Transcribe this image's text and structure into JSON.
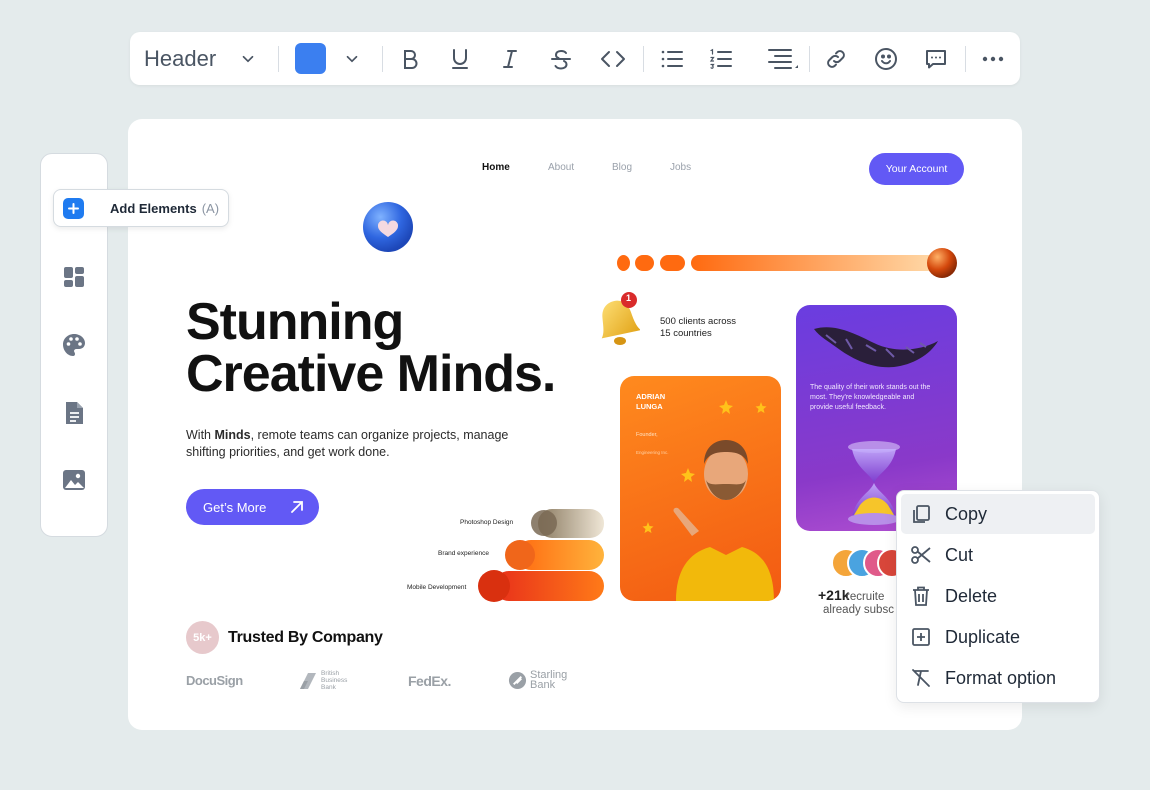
{
  "toolbar": {
    "heading_select": "Header",
    "color_swatch": "#3b7ff0",
    "icons": [
      "bold-icon",
      "underline-icon",
      "italic-icon",
      "strikethrough-icon",
      "code-icon",
      "bullet-list-icon",
      "numbered-list-icon",
      "align-right-icon",
      "link-icon",
      "emoji-icon",
      "comment-icon",
      "more-icon"
    ]
  },
  "sidebar": {
    "add_elements_label": "Add Elements",
    "add_elements_shortcut": "(A)",
    "items": [
      "layout-icon",
      "palette-icon",
      "document-icon",
      "image-icon"
    ]
  },
  "page": {
    "nav": {
      "home": "Home",
      "about": "About",
      "blog": "Blog",
      "jobs": "Jobs"
    },
    "account_button": "Your Account",
    "headline_line1": "Stunning",
    "headline_line2": "Creative Minds.",
    "subtitle_pre": "With ",
    "subtitle_bold": "Minds",
    "subtitle_post": ", remote teams can organize projects, manage shifting priorities, and get work done.",
    "cta_label": "Get’s More",
    "clients_line1": "500 clients across",
    "clients_line2": "15 countries",
    "notification_count": "1",
    "skills": [
      "Photoshop Design",
      "Brand experience",
      "Mobile Development"
    ],
    "profile": {
      "name_line1": "ADRIAN",
      "name_line2": "LUNGA",
      "role": "Founder,",
      "company": "Engineering Inc."
    },
    "testimonial": "The quality of their work stands out the most. They're knowledgeable and provide useful feedback.",
    "recruit_number": "+21k",
    "recruit_text1": "recruite",
    "recruit_text2": "already subsc",
    "trusted_badge": "5k+",
    "trusted_title": "Trusted By Company",
    "logos": {
      "docusign": "DocuSign",
      "bbb_line1": "British",
      "bbb_line2": "Business",
      "bbb_line3": "Bank",
      "fedex": "FedEx.",
      "starling1": "Starling",
      "starling2": "Bank"
    }
  },
  "context_menu": {
    "items": [
      {
        "label": "Copy",
        "icon": "copy-icon"
      },
      {
        "label": "Cut",
        "icon": "scissors-icon"
      },
      {
        "label": "Delete",
        "icon": "trash-icon"
      },
      {
        "label": "Duplicate",
        "icon": "duplicate-icon"
      },
      {
        "label": "Format option",
        "icon": "clear-format-icon"
      }
    ]
  },
  "colors": {
    "accent": "#6259f5",
    "primary_blue": "#3b7ff0",
    "background": "#e4ebec"
  }
}
